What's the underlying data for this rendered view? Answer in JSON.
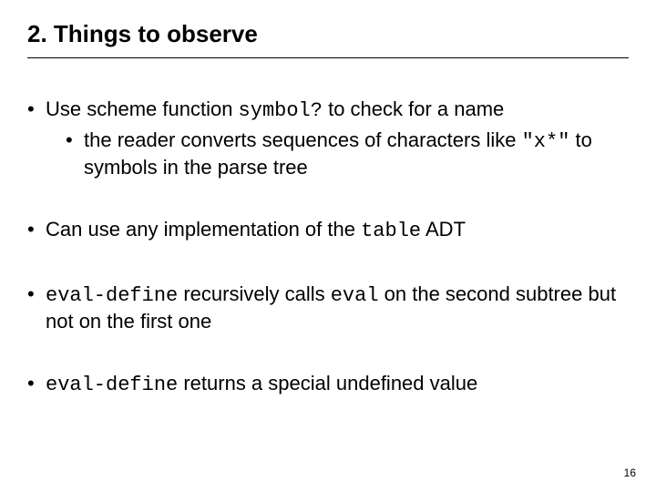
{
  "title": "2. Things to observe",
  "bullets": {
    "b1": {
      "pre": "Use scheme function ",
      "code": "symbol?",
      "post": " to check for a name",
      "sub": {
        "pre": "the reader converts sequences of characters like ",
        "code": "\"x*\"",
        "post": " to symbols in the parse tree"
      }
    },
    "b2": {
      "pre": "Can use any implementation of the ",
      "code": "table",
      "post": " ADT"
    },
    "b3": {
      "code1": "eval-define",
      "mid": " recursively calls ",
      "code2": "eval",
      "post": " on the second subtree but not on the first one"
    },
    "b4": {
      "code": "eval-define",
      "post": " returns a special undefined value"
    }
  },
  "page_number": "16"
}
